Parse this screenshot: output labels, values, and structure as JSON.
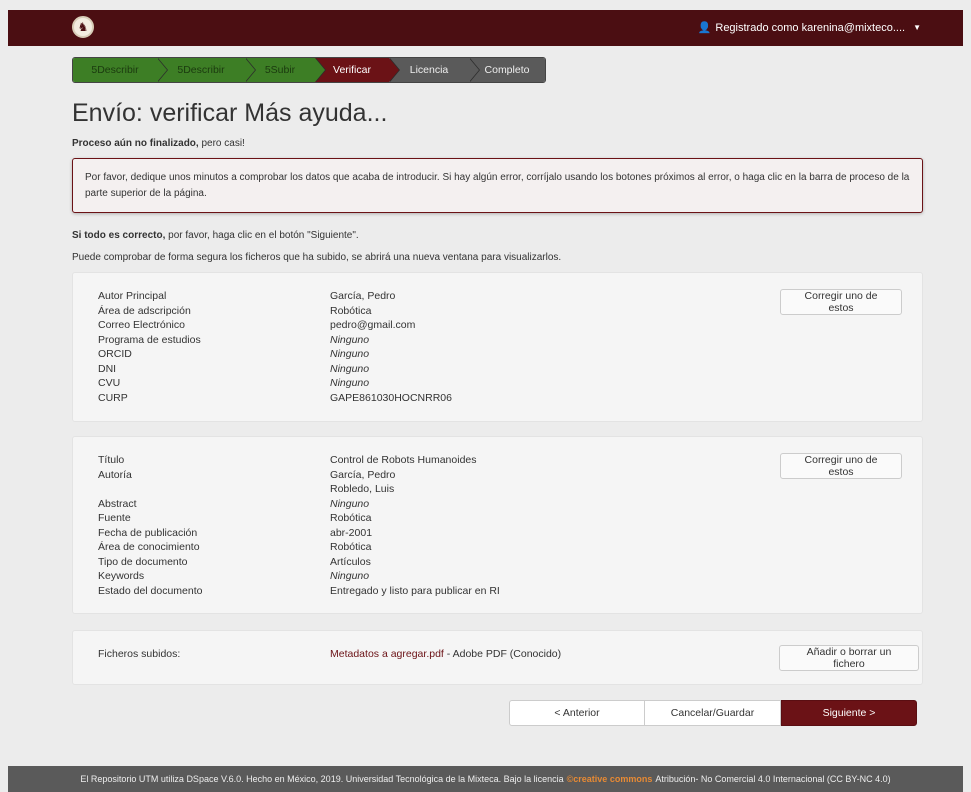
{
  "header": {
    "logo_glyph": "♞",
    "user_icon": "user-icon",
    "user_label": "Registrado como karenina@mixteco....",
    "caret": "▼"
  },
  "steps": [
    {
      "label": "5Describir",
      "state": "done"
    },
    {
      "label": "5Describir",
      "state": "done"
    },
    {
      "label": "5Subir",
      "state": "done"
    },
    {
      "label": "Verificar",
      "state": "active"
    },
    {
      "label": "Licencia",
      "state": "todo"
    },
    {
      "label": "Completo",
      "state": "todo"
    }
  ],
  "title": {
    "main": "Envío: verificar",
    "help": "Más ayuda..."
  },
  "subtitle": {
    "bold": "Proceso aún no finalizado,",
    "rest": " pero casi!"
  },
  "alert": "Por favor, dedique unos minutos a comprobar los datos que acaba de introducir. Si hay algún error, corríjalo usando los botones próximos al error, o haga clic en la barra de proceso de la parte superior de la página.",
  "line1": {
    "bold": "Si todo es correcto,",
    "rest": " por favor, haga clic en el botón \"Siguiente\"."
  },
  "line2": "Puede comprobar de forma segura los ficheros que ha subido, se abrirá una nueva ventana para visualizarlos.",
  "section1": {
    "button": "Corregir uno de estos",
    "rows": [
      {
        "k": "Autor Principal",
        "v": "García, Pedro",
        "none": false
      },
      {
        "k": "Área de adscripción",
        "v": "Robótica",
        "none": false
      },
      {
        "k": "Correo Electrónico",
        "v": "pedro@gmail.com",
        "none": false
      },
      {
        "k": "Programa de estudios",
        "v": "Ninguno",
        "none": true
      },
      {
        "k": "ORCID",
        "v": "Ninguno",
        "none": true
      },
      {
        "k": "DNI",
        "v": "Ninguno",
        "none": true
      },
      {
        "k": "CVU",
        "v": "Ninguno",
        "none": true
      },
      {
        "k": "CURP",
        "v": "GAPE861030HOCNRR06",
        "none": false
      }
    ]
  },
  "section2": {
    "button": "Corregir uno de estos",
    "rows": [
      {
        "k": "Título",
        "v": "Control de Robots Humanoides",
        "none": false
      },
      {
        "k": "Autoría",
        "v": "García, Pedro",
        "none": false
      },
      {
        "k": "",
        "v": "Robledo, Luis",
        "none": false
      },
      {
        "k": "Abstract",
        "v": "Ninguno",
        "none": true
      },
      {
        "k": "Fuente",
        "v": "Robótica",
        "none": false
      },
      {
        "k": "Fecha de publicación",
        "v": "abr-2001",
        "none": false
      },
      {
        "k": "Área de conocimiento",
        "v": "Robótica",
        "none": false
      },
      {
        "k": "Tipo de documento",
        "v": "Artículos",
        "none": false
      },
      {
        "k": "Keywords",
        "v": "Ninguno",
        "none": true
      },
      {
        "k": "Estado del documento",
        "v": "Entregado y listo para publicar en RI",
        "none": false
      }
    ]
  },
  "section3": {
    "label": "Ficheros subidos:",
    "file": "Metadatos a agregar.pdf",
    "file_info": " - Adobe PDF (Conocido)",
    "button": "Añadir o borrar un fichero"
  },
  "nav": {
    "prev": "< Anterior",
    "cancel": "Cancelar/Guardar",
    "next": "Siguiente >"
  },
  "footer": {
    "text": "El Repositorio UTM utiliza DSpace V.6.0. Hecho en México, 2019. Universidad Tecnológica de la Mixteca. Bajo la licencia",
    "cc": "©creative commons",
    "license": "Atribución- No Comercial 4.0 Internacional (CC BY-NC 4.0)"
  },
  "colors": {
    "brand": "#4b0e12",
    "accent": "#6b1216",
    "done": "#3d7e25",
    "todo": "#5a5a5a"
  }
}
